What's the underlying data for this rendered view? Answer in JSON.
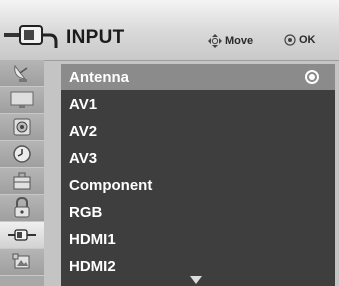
{
  "menu": {
    "title": "INPUT",
    "move_hint": "Move",
    "ok_hint": "OK"
  },
  "sidebar": [
    {
      "icon": "satellite-dish-icon",
      "active": false
    },
    {
      "icon": "picture-icon",
      "active": false
    },
    {
      "icon": "audio-speaker-icon",
      "active": false
    },
    {
      "icon": "clock-icon",
      "active": false
    },
    {
      "icon": "option-toolbox-icon",
      "active": false
    },
    {
      "icon": "lock-icon",
      "active": false
    },
    {
      "icon": "input-plug-icon",
      "active": true
    },
    {
      "icon": "usb-photo-icon",
      "active": false
    }
  ],
  "inputs": [
    {
      "label": "Antenna",
      "selected": true
    },
    {
      "label": "AV1",
      "selected": false
    },
    {
      "label": "AV2",
      "selected": false
    },
    {
      "label": "AV3",
      "selected": false
    },
    {
      "label": "Component",
      "selected": false
    },
    {
      "label": "RGB",
      "selected": false
    },
    {
      "label": "HDMI1",
      "selected": false
    },
    {
      "label": "HDMI2",
      "selected": false
    }
  ],
  "colors": {
    "list_background": "#3e3e3e",
    "selected_row": "#8b8b8b",
    "text": "#ffffff"
  }
}
